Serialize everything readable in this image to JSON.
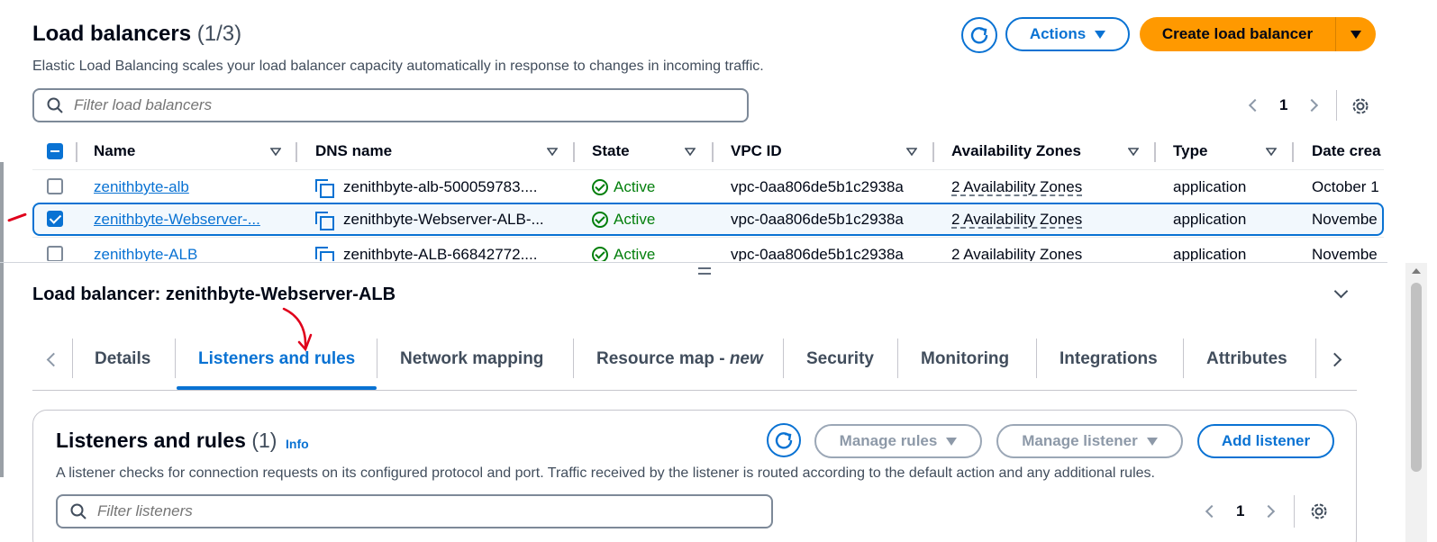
{
  "header": {
    "title": "Load balancers",
    "count": "(1/3)",
    "description": "Elastic Load Balancing scales your load balancer capacity automatically in response to changes in incoming traffic.",
    "actions_label": "Actions",
    "create_label": "Create load balancer"
  },
  "filter": {
    "placeholder": "Filter load balancers"
  },
  "pager": {
    "page": "1"
  },
  "table": {
    "columns": [
      "Name",
      "DNS name",
      "State",
      "VPC ID",
      "Availability Zones",
      "Type",
      "Date crea"
    ],
    "rows": [
      {
        "name": "zenithbyte-alb",
        "dns": "zenithbyte-alb-500059783....",
        "state": "Active",
        "vpc": "vpc-0aa806de5b1c2938a",
        "az": "2 Availability Zones",
        "type": "application",
        "date": "October 1",
        "selected": false
      },
      {
        "name": "zenithbyte-Webserver-...",
        "dns": "zenithbyte-Webserver-ALB-...",
        "state": "Active",
        "vpc": "vpc-0aa806de5b1c2938a",
        "az": "2 Availability Zones",
        "type": "application",
        "date": "Novembe",
        "selected": true
      },
      {
        "name": "zenithbyte-ALB",
        "dns": "zenithbyte-ALB-66842772....",
        "state": "Active",
        "vpc": "vpc-0aa806de5b1c2938a",
        "az": "2 Availability Zones",
        "type": "application",
        "date": "Novembe",
        "selected": false
      }
    ]
  },
  "details": {
    "title": "Load balancer: zenithbyte-Webserver-ALB",
    "tabs": [
      "Details",
      "Listeners and rules",
      "Network mapping",
      "Resource map - ",
      "Security",
      "Monitoring",
      "Integrations",
      "Attributes"
    ],
    "tab_new": "new",
    "active_tab": "Listeners and rules"
  },
  "listeners": {
    "title": "Listeners and rules",
    "count": "(1)",
    "info": "Info",
    "description": "A listener checks for connection requests on its configured protocol and port. Traffic received by the listener is routed according to the default action and any additional rules.",
    "manage_rules": "Manage rules",
    "manage_listener": "Manage listener",
    "add_listener": "Add listener",
    "filter_placeholder": "Filter listeners",
    "page": "1"
  },
  "colors": {
    "accent": "#0972d3",
    "primary": "#ff9900",
    "success": "#037f0c",
    "annotation": "#e0001b"
  }
}
